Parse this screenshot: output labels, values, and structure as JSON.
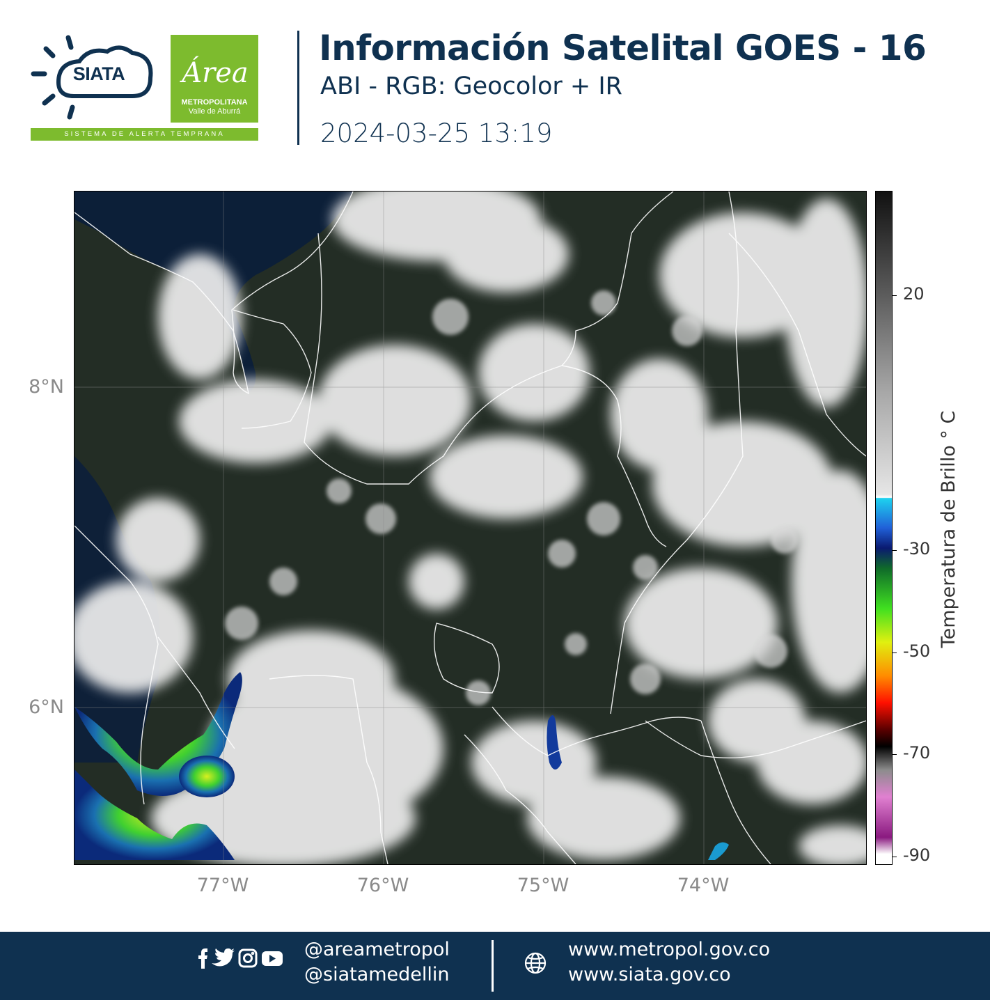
{
  "header": {
    "siata_logo_text": "SIATA",
    "area_logo_script": "Área",
    "area_logo_line1": "METROPOLITANA",
    "area_logo_line2": "Valle de Aburrá",
    "siata_banner": "SISTEMA DE ALERTA TEMPRANA",
    "title": "Información Satelital GOES - 16",
    "subtitle": "ABI - RGB: Geocolor + IR",
    "timestamp": "2024-03-25 13:19"
  },
  "map": {
    "lat_labels": [
      "8°N",
      "6°N"
    ],
    "lon_labels": [
      "77°W",
      "76°W",
      "75°W",
      "74°W"
    ],
    "colors": {
      "ocean": "#0c1f38",
      "land": "#232d25",
      "cloud": "#f3f3f3",
      "borders": "#ffffff"
    }
  },
  "colorbar": {
    "label": "Temperatura de Brillo ° C",
    "ticks": [
      "20",
      "-30",
      "-50",
      "-70",
      "-90"
    ]
  },
  "footer": {
    "handle_1": "@areametropol",
    "handle_2": "@siatamedellin",
    "url_1": "www.metropol.gov.co",
    "url_2": "www.siata.gov.co",
    "icons": [
      "facebook-icon",
      "twitter-icon",
      "instagram-icon",
      "youtube-icon",
      "globe-icon"
    ]
  }
}
